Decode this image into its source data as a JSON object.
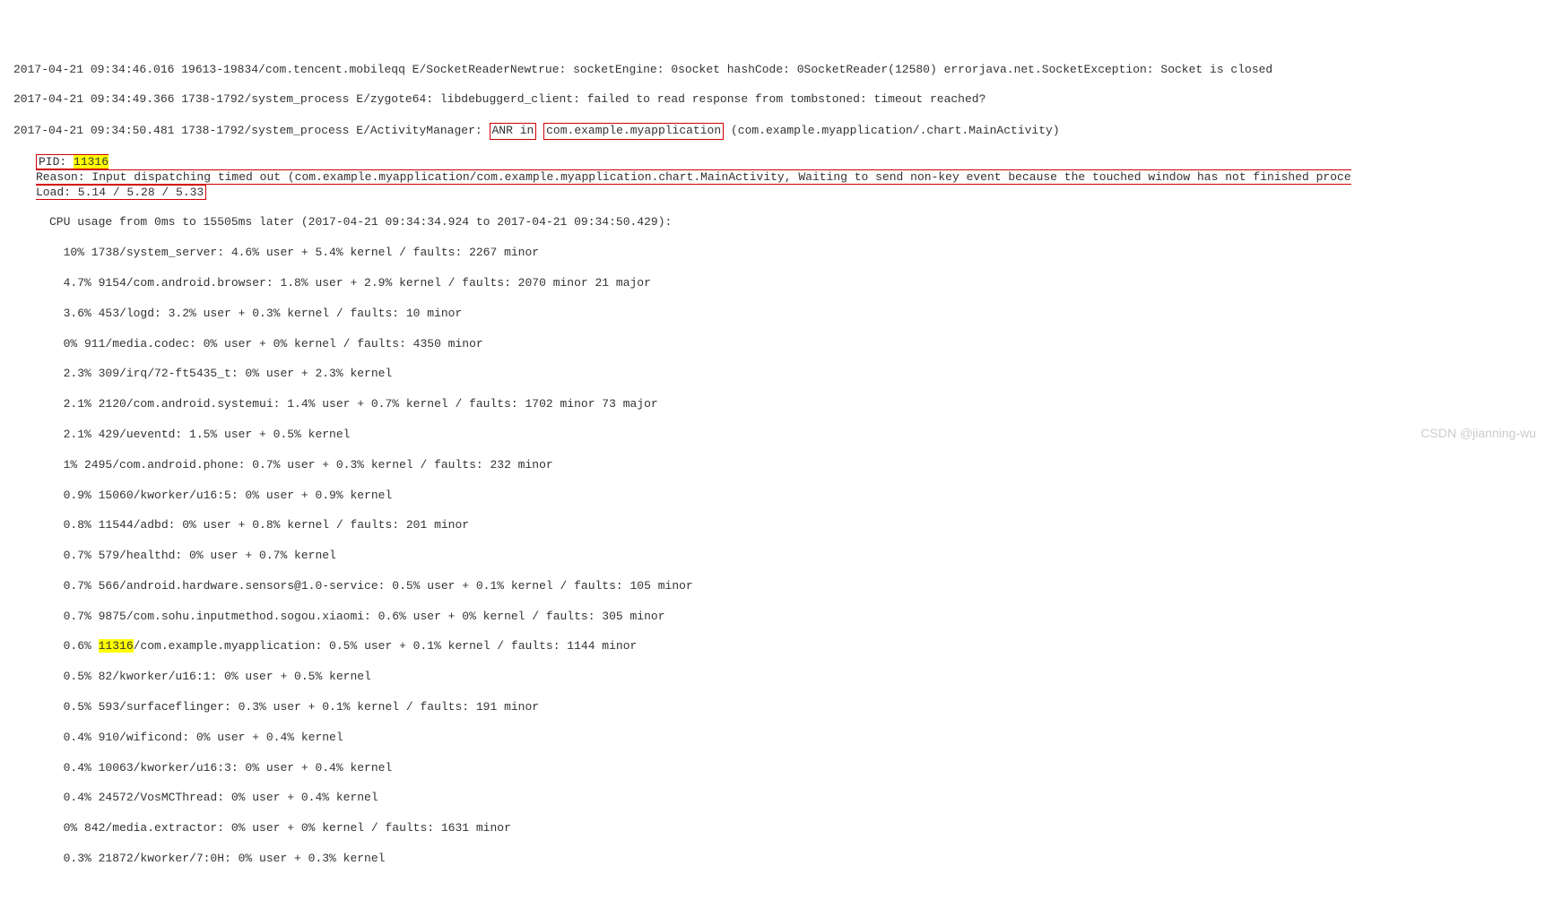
{
  "lines": {
    "l1": "2017-04-21 09:34:46.016 19613-19834/com.tencent.mobileqq E/SocketReaderNewtrue: socketEngine: 0socket hashCode: 0SocketReader(12580) errorjava.net.SocketException: Socket is closed",
    "l2": "2017-04-21 09:34:49.366 1738-1792/system_process E/zygote64: libdebuggerd_client: failed to read response from tombstoned: timeout reached?",
    "l3p1": "2017-04-21 09:34:50.481 1738-1792/system_process E/ActivityManager: ",
    "l3p2": "ANR in",
    "l3p3": " ",
    "l3p4": "com.example.myapplication",
    "l3p5": " (com.example.myapplication/.chart.MainActivity)",
    "l4p1": "PID: ",
    "l4p2": "11316",
    "l5": "Reason: Input dispatching timed out (com.example.myapplication/com.example.myapplication.chart.MainActivity, Waiting to send non-key event because the touched window has not finished proce",
    "l6": "Load: 5.14 / 5.28 / 5.33",
    "l7": "CPU usage from 0ms to 15505ms later (2017-04-21 09:34:34.924 to 2017-04-21 09:34:50.429):",
    "l8": "  10% 1738/system_server: 4.6% user + 5.4% kernel / faults: 2267 minor",
    "l9": "  4.7% 9154/com.android.browser: 1.8% user + 2.9% kernel / faults: 2070 minor 21 major",
    "l10": "  3.6% 453/logd: 3.2% user + 0.3% kernel / faults: 10 minor",
    "l11": "  0% 911/media.codec: 0% user + 0% kernel / faults: 4350 minor",
    "l12": "  2.3% 309/irq/72-ft5435_t: 0% user + 2.3% kernel",
    "l13": "  2.1% 2120/com.android.systemui: 1.4% user + 0.7% kernel / faults: 1702 minor 73 major",
    "l14": "  2.1% 429/ueventd: 1.5% user + 0.5% kernel",
    "l15": "  1% 2495/com.android.phone: 0.7% user + 0.3% kernel / faults: 232 minor",
    "l16": "  0.9% 15060/kworker/u16:5: 0% user + 0.9% kernel",
    "l17": "  0.8% 11544/adbd: 0% user + 0.8% kernel / faults: 201 minor",
    "l18": "  0.7% 579/healthd: 0% user + 0.7% kernel",
    "l19": "  0.7% 566/android.hardware.sensors@1.0-service: 0.5% user + 0.1% kernel / faults: 105 minor",
    "l20": "  0.7% 9875/com.sohu.inputmethod.sogou.xiaomi: 0.6% user + 0% kernel / faults: 305 minor",
    "l21p1": "  0.6% ",
    "l21p2": "11316",
    "l21p3": "/com.example.myapplication: 0.5% user + 0.1% kernel / faults: 1144 minor",
    "l22": "  0.5% 82/kworker/u16:1: 0% user + 0.5% kernel",
    "l23": "  0.5% 593/surfaceflinger: 0.3% user + 0.1% kernel / faults: 191 minor",
    "l24": "  0.4% 910/wificond: 0% user + 0.4% kernel",
    "l25": "  0.4% 10063/kworker/u16:3: 0% user + 0.4% kernel",
    "l26": "  0.4% 24572/VosMCThread: 0% user + 0.4% kernel",
    "l27": "  0% 842/media.extractor: 0% user + 0% kernel / faults: 1631 minor",
    "l28": "  0.3% 21872/kworker/7:0H: 0% user + 0.3% kernel"
  },
  "watermark": "CSDN @jianning-wu"
}
